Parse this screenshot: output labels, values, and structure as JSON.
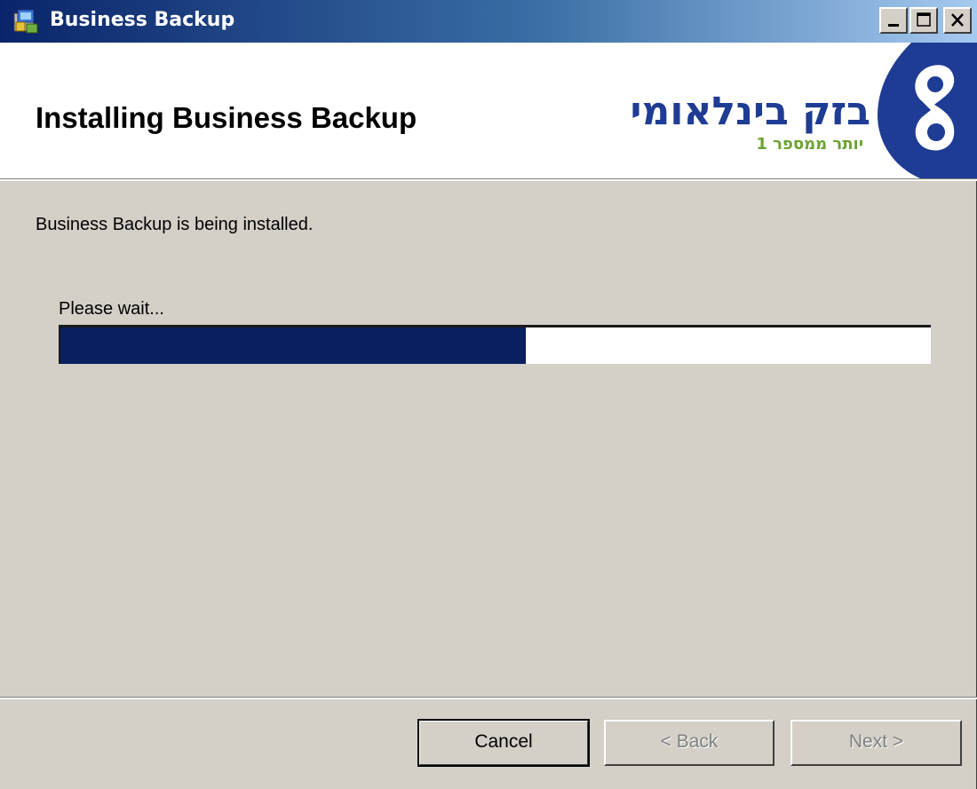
{
  "window": {
    "title": "Business Backup",
    "icon": "installer-package-icon",
    "controls": [
      "minimize-icon",
      "maximize-icon",
      "close-icon"
    ]
  },
  "banner": {
    "heading": "Installing Business Backup",
    "logo_name": "בזק בינלאומי",
    "logo_tagline": "יותר ממספר 1"
  },
  "body": {
    "status_text": "Business Backup is being installed.",
    "wait_label": "Please wait...",
    "progress": 0.535
  },
  "buttons": {
    "cancel": "Cancel",
    "back": "< Back",
    "next": "Next >"
  },
  "colors": {
    "titlebar_start": "#0a246a",
    "titlebar_end": "#a6caf0",
    "progress_fill": "#0a1f5f",
    "logo_blue": "#1f3c94",
    "logo_green": "#6aa32e"
  }
}
